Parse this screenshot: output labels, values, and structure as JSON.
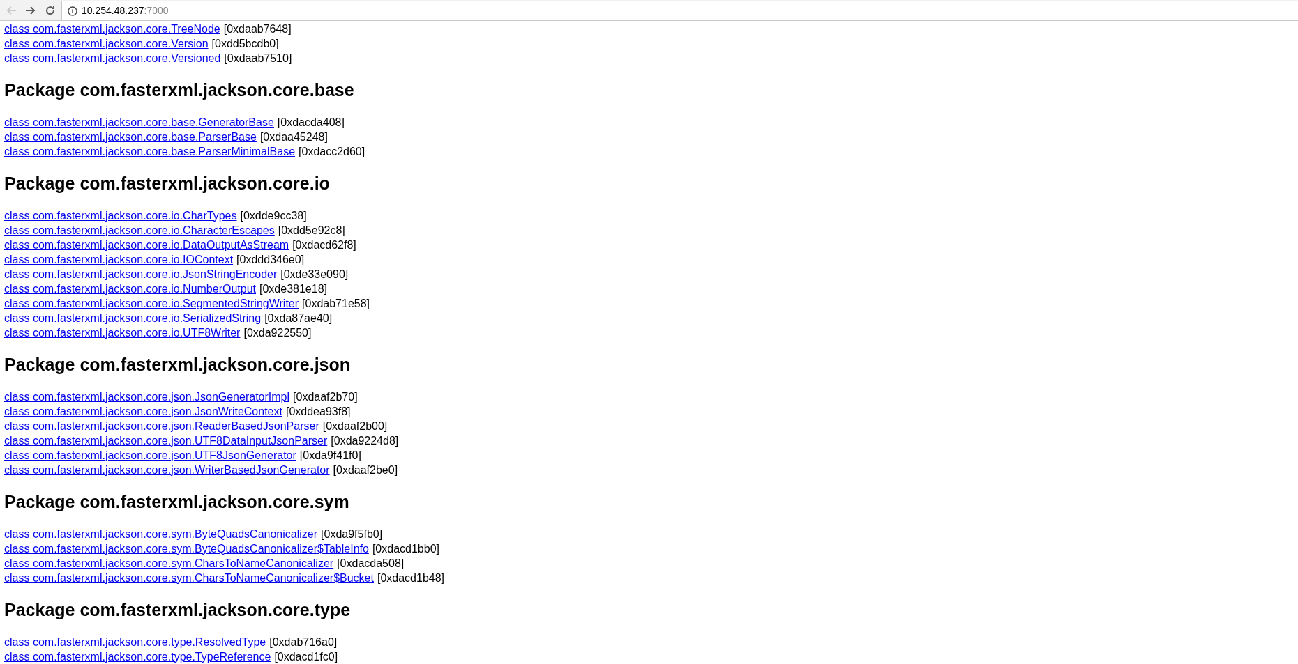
{
  "toolbar": {
    "back": {
      "disabled": true
    },
    "forward": {
      "disabled": false
    },
    "address": {
      "host": "10.254.48.237",
      "port": ":7000"
    }
  },
  "top_classes": [
    {
      "link": "class com.fasterxml.jackson.core.TreeNode",
      "address": "[0xdaab7648]"
    },
    {
      "link": "class com.fasterxml.jackson.core.Version",
      "address": "[0xdd5bcdb0]"
    },
    {
      "link": "class com.fasterxml.jackson.core.Versioned",
      "address": "[0xdaab7510]"
    }
  ],
  "packages": [
    {
      "heading": "Package com.fasterxml.jackson.core.base",
      "classes": [
        {
          "link": "class com.fasterxml.jackson.core.base.GeneratorBase",
          "address": "[0xdacda408]"
        },
        {
          "link": "class com.fasterxml.jackson.core.base.ParserBase",
          "address": "[0xdaa45248]"
        },
        {
          "link": "class com.fasterxml.jackson.core.base.ParserMinimalBase",
          "address": "[0xdacc2d60]"
        }
      ]
    },
    {
      "heading": "Package com.fasterxml.jackson.core.io",
      "classes": [
        {
          "link": "class com.fasterxml.jackson.core.io.CharTypes",
          "address": "[0xdde9cc38]"
        },
        {
          "link": "class com.fasterxml.jackson.core.io.CharacterEscapes",
          "address": "[0xdd5e92c8]"
        },
        {
          "link": "class com.fasterxml.jackson.core.io.DataOutputAsStream",
          "address": "[0xdacd62f8]"
        },
        {
          "link": "class com.fasterxml.jackson.core.io.IOContext",
          "address": "[0xddd346e0]"
        },
        {
          "link": "class com.fasterxml.jackson.core.io.JsonStringEncoder",
          "address": "[0xde33e090]"
        },
        {
          "link": "class com.fasterxml.jackson.core.io.NumberOutput",
          "address": "[0xde381e18]"
        },
        {
          "link": "class com.fasterxml.jackson.core.io.SegmentedStringWriter",
          "address": "[0xdab71e58]"
        },
        {
          "link": "class com.fasterxml.jackson.core.io.SerializedString",
          "address": "[0xda87ae40]"
        },
        {
          "link": "class com.fasterxml.jackson.core.io.UTF8Writer",
          "address": "[0xda922550]"
        }
      ]
    },
    {
      "heading": "Package com.fasterxml.jackson.core.json",
      "classes": [
        {
          "link": "class com.fasterxml.jackson.core.json.JsonGeneratorImpl",
          "address": "[0xdaaf2b70]"
        },
        {
          "link": "class com.fasterxml.jackson.core.json.JsonWriteContext",
          "address": "[0xddea93f8]"
        },
        {
          "link": "class com.fasterxml.jackson.core.json.ReaderBasedJsonParser",
          "address": "[0xdaaf2b00]"
        },
        {
          "link": "class com.fasterxml.jackson.core.json.UTF8DataInputJsonParser",
          "address": "[0xda9224d8]"
        },
        {
          "link": "class com.fasterxml.jackson.core.json.UTF8JsonGenerator",
          "address": "[0xda9f41f0]"
        },
        {
          "link": "class com.fasterxml.jackson.core.json.WriterBasedJsonGenerator",
          "address": "[0xdaaf2be0]"
        }
      ]
    },
    {
      "heading": "Package com.fasterxml.jackson.core.sym",
      "classes": [
        {
          "link": "class com.fasterxml.jackson.core.sym.ByteQuadsCanonicalizer",
          "address": "[0xda9f5fb0]"
        },
        {
          "link": "class com.fasterxml.jackson.core.sym.ByteQuadsCanonicalizer$TableInfo",
          "address": "[0xdacd1bb0]"
        },
        {
          "link": "class com.fasterxml.jackson.core.sym.CharsToNameCanonicalizer",
          "address": "[0xdacda508]"
        },
        {
          "link": "class com.fasterxml.jackson.core.sym.CharsToNameCanonicalizer$Bucket",
          "address": "[0xdacd1b48]"
        }
      ]
    },
    {
      "heading": "Package com.fasterxml.jackson.core.type",
      "classes": [
        {
          "link": "class com.fasterxml.jackson.core.type.ResolvedType",
          "address": "[0xdab716a0]"
        },
        {
          "link": "class com.fasterxml.jackson.core.type.TypeReference",
          "address": "[0xdacd1fc0]"
        }
      ]
    }
  ]
}
